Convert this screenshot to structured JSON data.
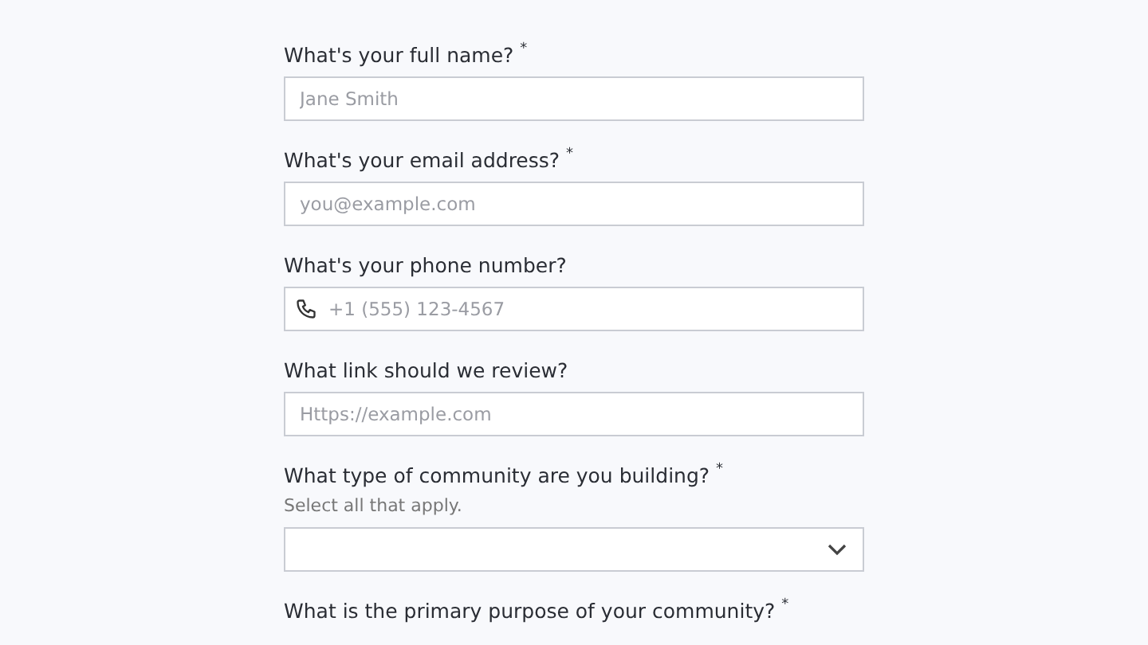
{
  "questions": [
    {
      "label": "What's your full name?",
      "mark": "*",
      "kind": "text",
      "placeholder": "Jane Smith"
    },
    {
      "label": "What's your email address?",
      "mark": "*",
      "kind": "text",
      "placeholder": "you@example.com"
    },
    {
      "label": "What's your phone number?",
      "kind": "phone",
      "placeholder": "+1 (555) 123-4567"
    },
    {
      "label": "What link should we review?",
      "kind": "text",
      "placeholder": "Https://example.com"
    },
    {
      "label": "What type of community are you building?",
      "mark": "*",
      "hint": "Select all that apply.",
      "kind": "select"
    },
    {
      "label": "What is the primary purpose of your community?",
      "mark": "*",
      "kind": "none"
    }
  ]
}
